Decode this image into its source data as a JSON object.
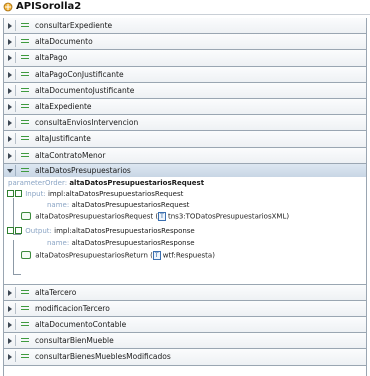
{
  "title": "APISorolla2",
  "icons": {
    "service": "wsdl-service-icon",
    "operation": "operation-icon"
  },
  "operations_before": [
    "consultarExpediente",
    "altaDocumento",
    "altaPago",
    "altaPagoConJustificante",
    "altaDocumentoJustificante",
    "altaExpediente",
    "consultaEnviosIntervencion",
    "altaJustificante",
    "altaContratoMenor"
  ],
  "expanded": {
    "name": "altaDatosPresupuestarios",
    "parameter_order_key": "parameterOrder:",
    "parameter_order_value": "altaDatosPresupuestariosRequest",
    "input": {
      "key": "Input:",
      "value": "impl:altaDatosPresupuestariosRequest",
      "name_key": "name:",
      "name_value": "altaDatosPresupuestariosRequest",
      "element": "altaDatosPresupuestariosRequest",
      "type_tag": "T",
      "type_value": "tns3:TODatosPresupuestariosXML"
    },
    "output": {
      "key": "Output:",
      "value": "impl:altaDatosPresupuestariosResponse",
      "name_key": "name:",
      "name_value": "altaDatosPresupuestariosResponse",
      "element": "altaDatosPresupuestariosReturn",
      "type_tag": "T",
      "type_value": "wtf:Respuesta"
    }
  },
  "operations_after": [
    "altaTercero",
    "modificacionTercero",
    "altaDocumentoContable",
    "consultarBienMueble",
    "consultarBienesMueblesModificados"
  ]
}
